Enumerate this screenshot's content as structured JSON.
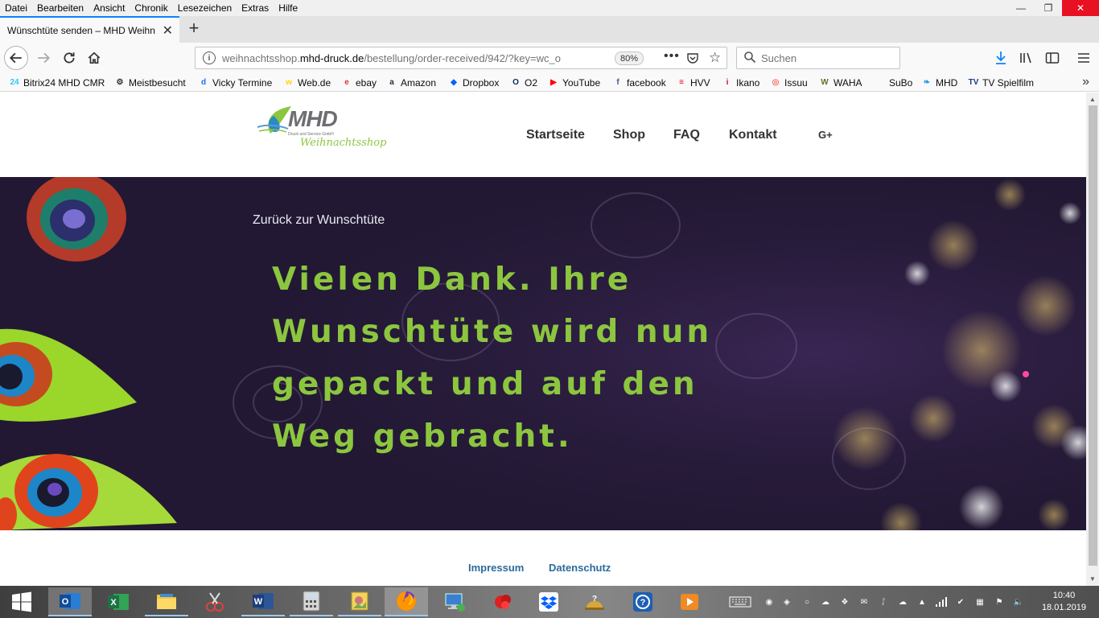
{
  "menu": [
    "Datei",
    "Bearbeiten",
    "Ansicht",
    "Chronik",
    "Lesezeichen",
    "Extras",
    "Hilfe"
  ],
  "tab": {
    "title": "Wünschtüte senden – MHD Weihn"
  },
  "nav": {
    "url_domain_prefix": "weihnachtsshop.",
    "url_domain": "mhd-druck.de",
    "url_path": "/bestellung/order-received/942/?key=wc_o",
    "zoom": "80%",
    "search_placeholder": "Suchen"
  },
  "bookmarks": [
    {
      "label": "Bitrix24 MHD CMR",
      "icon": "bitrix24-icon",
      "color": "#2fc6f6",
      "glyph": "24"
    },
    {
      "label": "Meistbesucht",
      "icon": "gear-icon",
      "color": "#333333",
      "glyph": "⚙"
    },
    {
      "label": "Vicky Termine",
      "icon": "d-icon",
      "color": "#1a73e8",
      "glyph": "d"
    },
    {
      "label": "Web.de",
      "icon": "webde-icon",
      "color": "#ffd800",
      "glyph": "w"
    },
    {
      "label": "ebay",
      "icon": "ebay-icon",
      "color": "#e53238",
      "glyph": "e"
    },
    {
      "label": "Amazon",
      "icon": "amazon-icon",
      "color": "#232f3e",
      "glyph": "a"
    },
    {
      "label": "Dropbox",
      "icon": "dropbox-icon",
      "color": "#0061fe",
      "glyph": "◆"
    },
    {
      "label": "O2",
      "icon": "o2-icon",
      "color": "#032b5a",
      "glyph": "O"
    },
    {
      "label": "YouTube",
      "icon": "youtube-icon",
      "color": "#ff0000",
      "glyph": "▶"
    },
    {
      "label": "facebook",
      "icon": "facebook-icon",
      "color": "#3b5998",
      "glyph": "f"
    },
    {
      "label": "HVV",
      "icon": "hvv-icon",
      "color": "#e2001a",
      "glyph": "≡"
    },
    {
      "label": "Ikano",
      "icon": "ikano-icon",
      "color": "#c8102e",
      "glyph": "i"
    },
    {
      "label": "Issuu",
      "icon": "issuu-icon",
      "color": "#f36d5d",
      "glyph": "◎"
    },
    {
      "label": "WAHA",
      "icon": "waha-icon",
      "color": "#6b6b2f",
      "glyph": "W"
    },
    {
      "label": "SuBo",
      "icon": "",
      "color": "",
      "glyph": ""
    },
    {
      "label": "MHD",
      "icon": "mhd-leaf-icon",
      "color": "#2d9cdb",
      "glyph": "❧"
    },
    {
      "label": "TV Spielfilm",
      "icon": "tvspielfilm-icon",
      "color": "#1a3a8a",
      "glyph": "TV"
    }
  ],
  "site": {
    "logo_text": "MHD",
    "logo_subtext": "Druck und Service GmbH",
    "logo_script": "Weihnachtsshop",
    "nav": [
      "Startseite",
      "Shop",
      "FAQ",
      "Kontakt"
    ],
    "social": "G+",
    "back_link": "Zurück zur Wunschtüte",
    "headline": "Vielen Dank. Ihre Wunschtüte wird nun gepackt und auf den Weg gebracht.",
    "footer_links": [
      "Impressum",
      "Datenschutz"
    ],
    "colors": {
      "accent_green": "#8cc63f",
      "hero_bg": "#241a35",
      "link_blue": "#2b6a9c"
    }
  },
  "taskbar": {
    "apps": [
      "windows-start-icon",
      "outlook-icon",
      "excel-icon",
      "file-explorer-icon",
      "snipping-tool-icon",
      "word-icon",
      "calculator-icon",
      "photo-viewer-icon",
      "firefox-icon",
      "remote-desktop-icon",
      "app-red-icon",
      "dropbox-icon",
      "help-desk-icon",
      "support-icon",
      "media-player-icon"
    ],
    "time": "10:40",
    "date": "18.01.2019"
  }
}
